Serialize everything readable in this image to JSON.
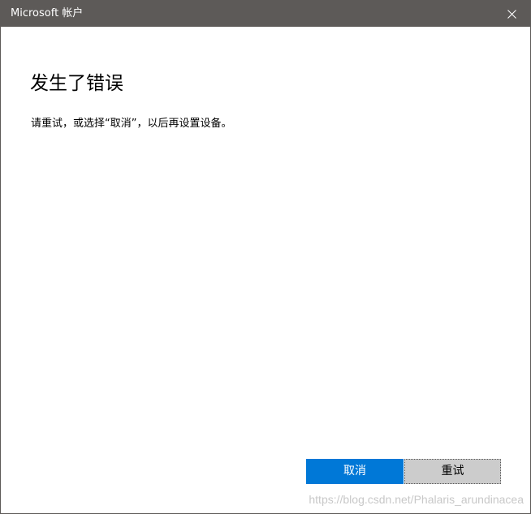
{
  "window": {
    "title": "Microsoft 帐户",
    "titlebar_color": "#5d5a58"
  },
  "titlebar": {
    "close_icon": "close-icon"
  },
  "content": {
    "heading": "发生了错误",
    "message": "请重试，或选择“取消”，以后再设置设备。"
  },
  "buttons": {
    "cancel_label": "取消",
    "retry_label": "重试",
    "accent_color": "#0078d7"
  },
  "watermark": {
    "text": "https://blog.csdn.net/Phalaris_arundinacea"
  }
}
